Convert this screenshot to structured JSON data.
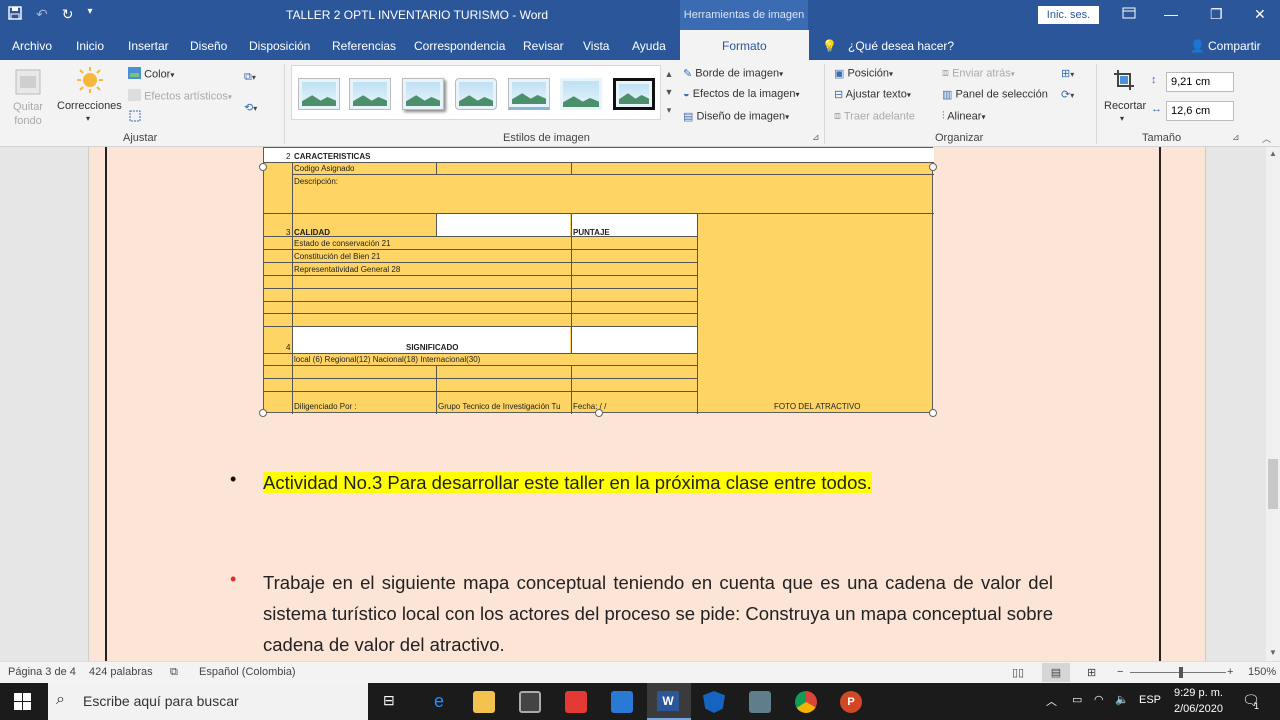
{
  "titlebar": {
    "title": "TALLER 2 OPTL INVENTARIO TURISMO  -  Word",
    "context": "Herramientas de imagen",
    "signin": "Inic. ses.",
    "min": "—",
    "restore": "❐",
    "close": "✕"
  },
  "tabs": [
    "Archivo",
    "Inicio",
    "Insertar",
    "Diseño",
    "Disposición",
    "Referencias",
    "Correspondencia",
    "Revisar",
    "Vista",
    "Ayuda"
  ],
  "active_tab": "Formato",
  "tell_me": "¿Qué desea hacer?",
  "share": "Compartir",
  "ribbon": {
    "remove_bg": "Quitar fondo",
    "corrections": "Correcciones",
    "color": "Color",
    "artistic": "Efectos artísticos",
    "group_adjust": "Ajustar",
    "group_styles": "Estilos de imagen",
    "border": "Borde de imagen",
    "effects": "Efectos de la imagen",
    "layout": "Diseño de imagen",
    "position": "Posición",
    "wrap": "Ajustar texto",
    "bring_forward": "Traer adelante",
    "send_back": "Enviar atrás",
    "selection_pane": "Panel de selección",
    "align": "Alinear",
    "group_arrange": "Organizar",
    "crop": "Recortar",
    "height": "9,21 cm",
    "width": "12,6 cm",
    "group_size": "Tamaño"
  },
  "form": {
    "r2_num": "2",
    "r2_title": "CARACTERISTICAS",
    "code": "Codigo Asignado",
    "desc": "Descripción:",
    "r3_num": "3",
    "quality": "CALIDAD",
    "score": "PUNTAJE",
    "cons": "Estado de conservación 21",
    "const": "Constitución del Bien 21",
    "repr": "Representatividad General 28",
    "r4_num": "4",
    "meaning": "SIGNIFICADO",
    "levels": "local (6)   Regional(12) Nacional(18)    Internacional(30)",
    "filled": "Diligenciado Por :",
    "group": "Grupo Tecnico de Investigación Tu",
    "date": "Fecha:       /        /",
    "photo": "FOTO DEL ATRACTIVO"
  },
  "doc": {
    "bullet1": "Actividad No.3 Para desarrollar este taller en la próxima clase entre todos.",
    "bullet2": "Trabaje en el siguiente  mapa conceptual teniendo en cuenta que es una cadena de valor del sistema turístico local con los actores del proceso se pide: Construya un mapa conceptual sobre cadena de valor del atractivo."
  },
  "status": {
    "page": "Página 3 de 4",
    "words": "424 palabras",
    "lang": "Español (Colombia)",
    "zoom": "150%",
    "minus": "−",
    "plus": "+"
  },
  "taskbar": {
    "search": "Escribe aquí para buscar",
    "lang": "ESP",
    "time": "9:29 p. m.",
    "date": "2/06/2020",
    "notif": "1"
  },
  "colors": {
    "word_blue": "#2b579a",
    "form_yellow": "#fed465",
    "page_bg": "#fce4d6",
    "highlight": "#ffff00"
  }
}
